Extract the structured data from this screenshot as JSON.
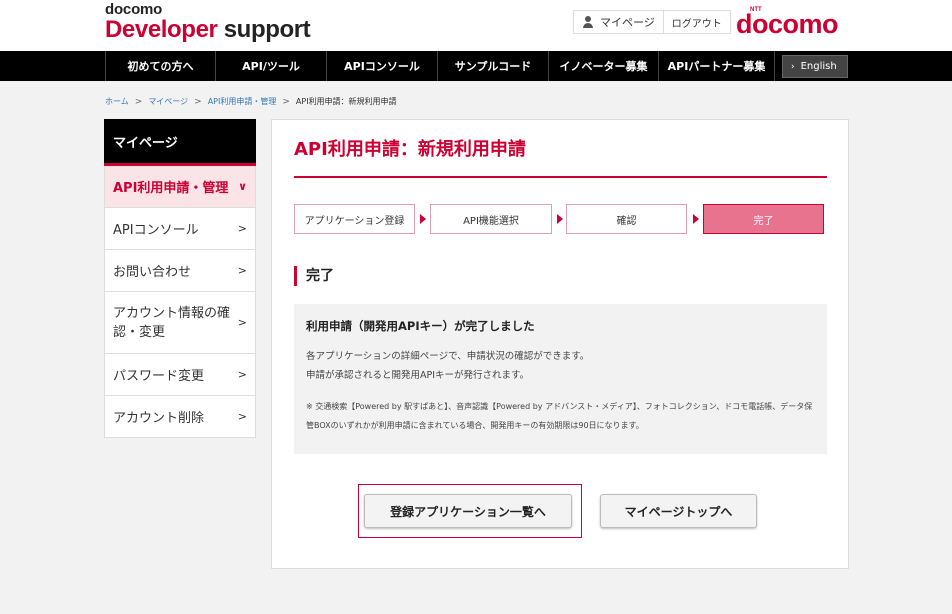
{
  "header": {
    "logo_small": "docomo",
    "logo_red": "Developer",
    "logo_dark": "support",
    "mypage_link": "マイページ",
    "logout_link": "ログアウト",
    "brand_ntt": "NTT",
    "brand_name": "docomo"
  },
  "nav": {
    "items": [
      {
        "label": "初めての方へ"
      },
      {
        "label": "API/ツール"
      },
      {
        "label": "APIコンソール"
      },
      {
        "label": "サンプルコード"
      },
      {
        "label": "イノベーター募集"
      },
      {
        "label": "APIパートナー募集"
      }
    ],
    "english": "English"
  },
  "breadcrumb": {
    "items": [
      "ホーム",
      "マイページ",
      "API利用申請・管理"
    ],
    "current": "API利用申請：新規利用申請"
  },
  "sidebar": {
    "title": "マイページ",
    "items": [
      {
        "label": "API利用申請・管理"
      },
      {
        "label": "APIコンソール"
      },
      {
        "label": "お問い合わせ"
      },
      {
        "label": "アカウント情報の確認・変更"
      },
      {
        "label": "パスワード変更"
      },
      {
        "label": "アカウント削除"
      }
    ]
  },
  "main": {
    "title": "API利用申請：新規利用申請",
    "steps": [
      {
        "label": "アプリケーション登録"
      },
      {
        "label": "API機能選択"
      },
      {
        "label": "確認"
      },
      {
        "label": "完了"
      }
    ],
    "section_title": "完了",
    "notice": {
      "heading": "利用申請（開発用APIキー）が完了しました",
      "line1": "各アプリケーションの詳細ページで、申請状況の確認ができます。",
      "line2": "申請が承認されると開発用APIキーが発行されます。",
      "note": "※ 交通検索【Powered by 駅すぱあと】、音声認識【Powered by アドバンスト・メディア】、フォトコレクション、ドコモ電話帳、データ保管BOXのいずれかが利用申請に含まれている場合、開発用キーの有効期限は90日になります。"
    },
    "buttons": {
      "app_list": "登録アプリケーション一覧へ",
      "mypage_top": "マイページトップへ"
    }
  },
  "colors": {
    "brand_red": "#cc0033",
    "step_done_bg": "#e8738e",
    "sidebar_active_bg": "#fbe4e8"
  }
}
